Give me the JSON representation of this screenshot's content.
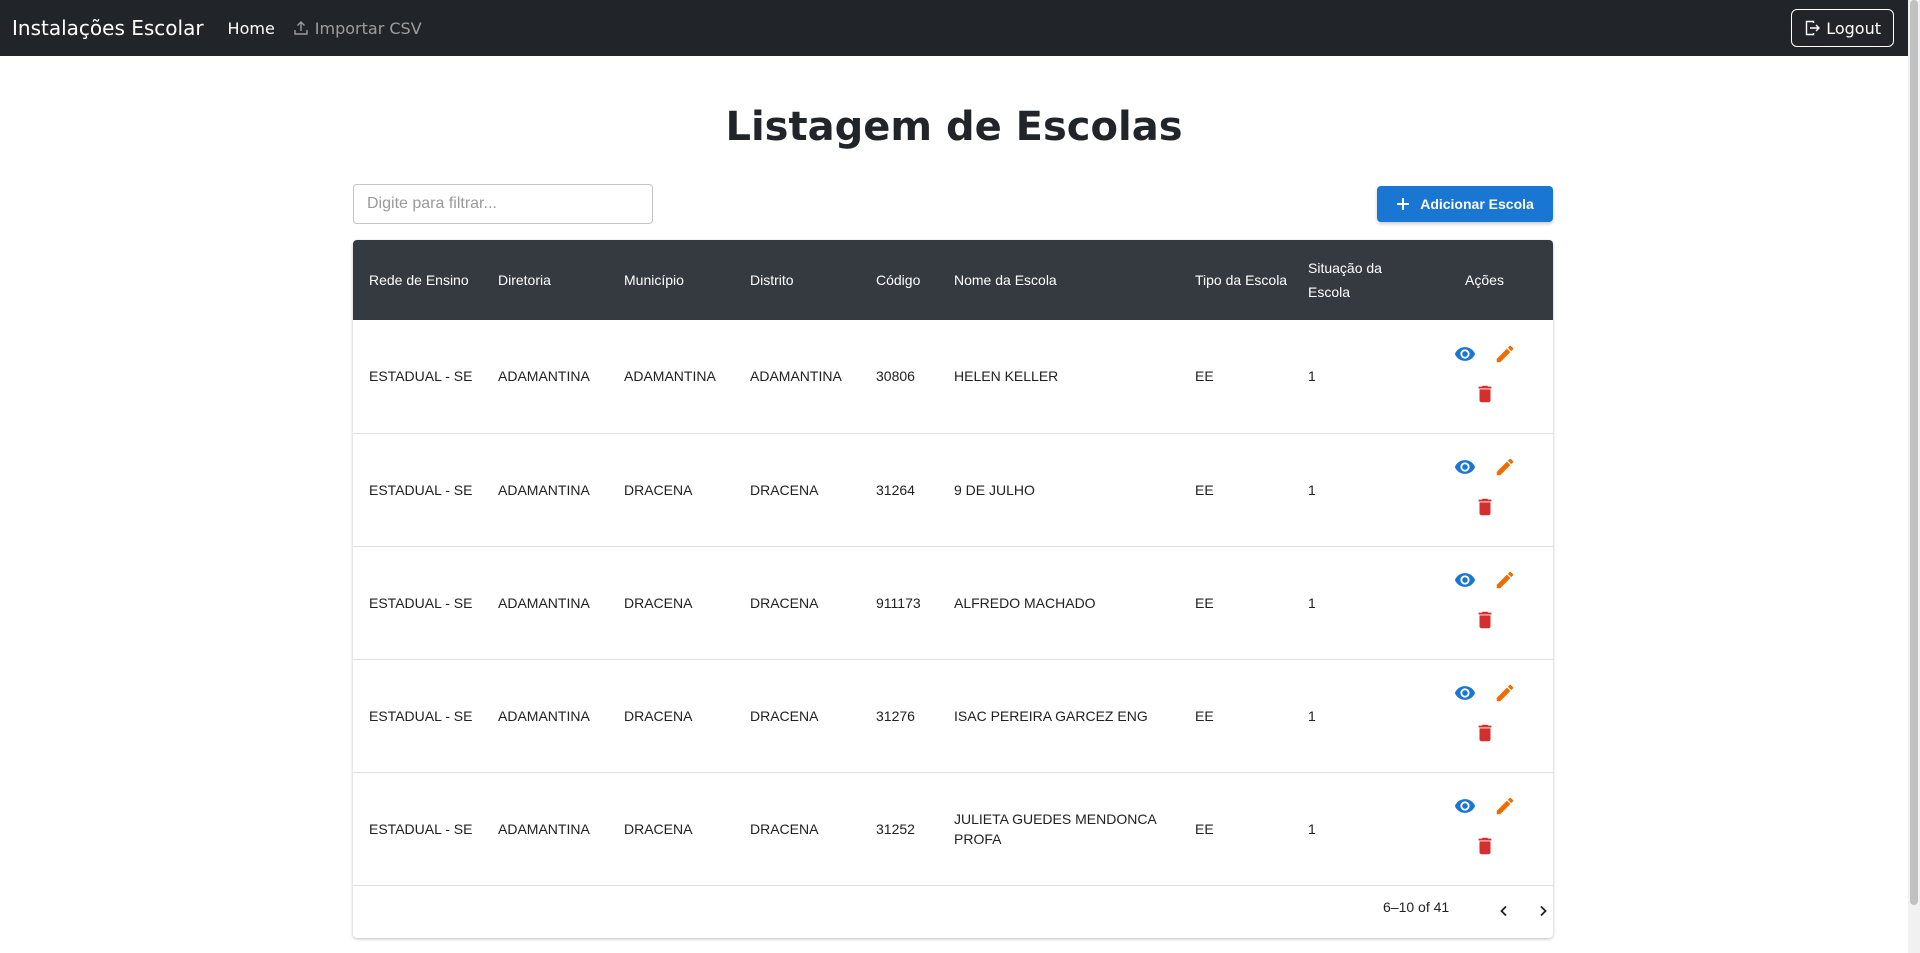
{
  "navbar": {
    "brand": "Instalações Escolar",
    "home_label": "Home",
    "import_label": "Importar CSV",
    "logout_label": "Logout"
  },
  "page": {
    "title": "Listagem de Escolas",
    "filter_placeholder": "Digite para filtrar...",
    "add_button_label": "Adicionar Escola"
  },
  "colors": {
    "navbar_bg": "#212529",
    "table_header_bg": "#343a40",
    "primary": "#1976d2",
    "edit": "#ef6c00",
    "delete": "#d32f2f"
  },
  "icons": {
    "import": "upload-icon",
    "logout": "logout-icon",
    "add": "plus-icon",
    "view": "eye-icon",
    "edit": "pencil-icon",
    "delete": "trash-icon",
    "prev": "chevron-left-icon",
    "next": "chevron-right-icon"
  },
  "table": {
    "columns": [
      "Rede de Ensino",
      "Diretoria",
      "Município",
      "Distrito",
      "Código",
      "Nome da Escola",
      "Tipo da Escola",
      "Situação da Escola",
      "Ações"
    ],
    "rows": [
      [
        "ESTADUAL - SE",
        "ADAMANTINA",
        "ADAMANTINA",
        "ADAMANTINA",
        "30806",
        "HELEN KELLER",
        "EE",
        "1"
      ],
      [
        "ESTADUAL - SE",
        "ADAMANTINA",
        "DRACENA",
        "DRACENA",
        "31264",
        "9 DE JULHO",
        "EE",
        "1"
      ],
      [
        "ESTADUAL - SE",
        "ADAMANTINA",
        "DRACENA",
        "DRACENA",
        "911173",
        "ALFREDO MACHADO",
        "EE",
        "1"
      ],
      [
        "ESTADUAL - SE",
        "ADAMANTINA",
        "DRACENA",
        "DRACENA",
        "31276",
        "ISAC PEREIRA GARCEZ ENG",
        "EE",
        "1"
      ],
      [
        "ESTADUAL - SE",
        "ADAMANTINA",
        "DRACENA",
        "DRACENA",
        "31252",
        "JULIETA GUEDES MENDONCA PROFA",
        "EE",
        "1"
      ]
    ]
  },
  "pagination": {
    "text": "6–10 of 41"
  }
}
